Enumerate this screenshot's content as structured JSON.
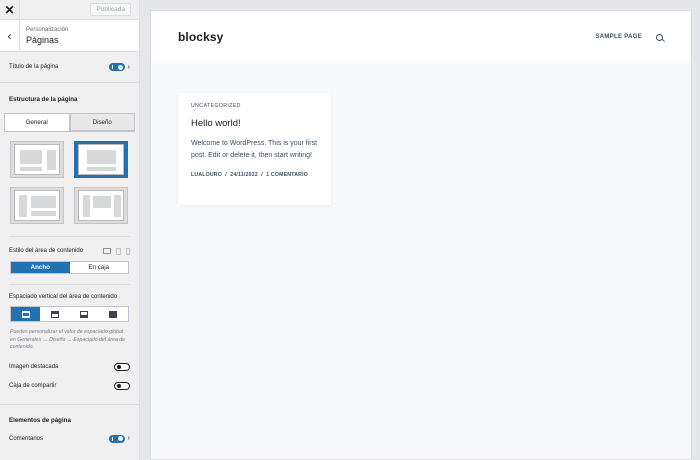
{
  "topbar": {
    "publish_label": "Publicada"
  },
  "section": {
    "breadcrumb": "Personalización",
    "title": "Páginas"
  },
  "page_title_row": {
    "label": "Título de la página",
    "enabled": true
  },
  "structure": {
    "title": "Estructura de la página",
    "tabs": [
      {
        "label": "General",
        "active": true
      },
      {
        "label": "Diseño",
        "active": false
      }
    ],
    "selected_layout_index": 1
  },
  "content_style": {
    "label": "Estilo del área de contenido",
    "options": [
      {
        "label": "Ancho",
        "active": true
      },
      {
        "label": "En caja",
        "active": false
      }
    ]
  },
  "vertical_spacing": {
    "label": "Espaciado vertical del área de contenido",
    "selected_index": 0,
    "note": "Puedes personalizar el valor de espaciado global en Generales → Diseño → Espaciado del área de contenido."
  },
  "featured_image": {
    "label": "Imagen destacada",
    "enabled": false
  },
  "share_box": {
    "label": "Caja de compartir",
    "enabled": false
  },
  "page_elements": {
    "title": "Elementos de página"
  },
  "comments": {
    "label": "Comentarios",
    "enabled": true
  },
  "preview": {
    "logo": "blocksy",
    "nav_item": "SAMPLE PAGE",
    "post": {
      "category": "UNCATEGORIZED",
      "title": "Hello world!",
      "excerpt": "Welcome to WordPress. This is your first post. Edit or delete it, then start writing!",
      "author": "LUALOURO",
      "date": "24/11/2022",
      "comments": "1 COMENTARIO"
    }
  },
  "colors": {
    "accent": "#2271b1",
    "sidebar_bg": "#f0f0f1",
    "preview_bg": "#f8f9fb"
  }
}
